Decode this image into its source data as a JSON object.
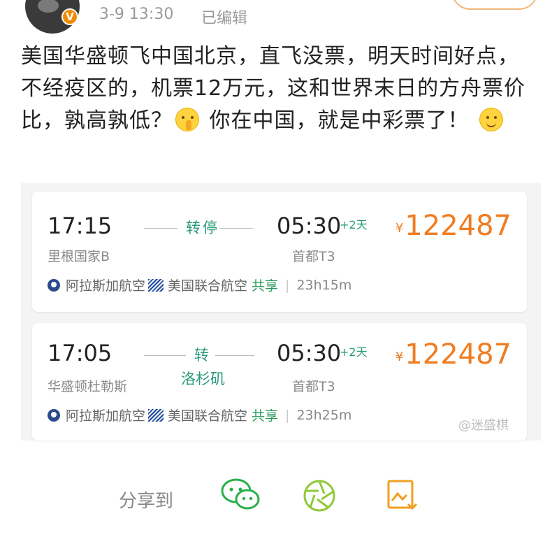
{
  "post": {
    "time": "3-9 13:30",
    "edited": "已编辑",
    "text_part1": "美国华盛顿飞中国北京，直飞没票，明天时间好点，不经疫区的，机票12万元，这和世界末日的方舟票价比，孰高孰低？",
    "text_part2": "你在中国，就是中彩票了！",
    "verified_badge": "V",
    "emojis": [
      "shush-emoji",
      "smile-emoji"
    ]
  },
  "flights": [
    {
      "dep_time": "17:15",
      "dep_airport": "里根国家B",
      "stop_label": "转停",
      "stop_city": "",
      "arr_time": "05:30",
      "plus_days": "+2天",
      "arr_airport": "首都T3",
      "currency": "¥",
      "price": "122487",
      "airline1": "阿拉斯加航空",
      "airline2": "美国联合航空",
      "shared": "共享",
      "separator": "|",
      "duration": "23h15m"
    },
    {
      "dep_time": "17:05",
      "dep_airport": "华盛顿杜勒斯",
      "stop_label": "转",
      "stop_city": "洛杉矶",
      "arr_time": "05:30",
      "plus_days": "+2天",
      "arr_airport": "首都T3",
      "currency": "¥",
      "price": "122487",
      "airline1": "阿拉斯加航空",
      "airline2": "美国联合航空",
      "shared": "共享",
      "separator": "|",
      "duration": "23h25m"
    }
  ],
  "watermark": "@迷盛棋",
  "share_bar": {
    "label": "分享到",
    "icons": [
      "wechat-icon",
      "moments-icon",
      "save-image-icon"
    ]
  },
  "colors": {
    "price": "#ef7d22",
    "transfer": "#2a9a7a",
    "shared": "#2a9a5a"
  }
}
